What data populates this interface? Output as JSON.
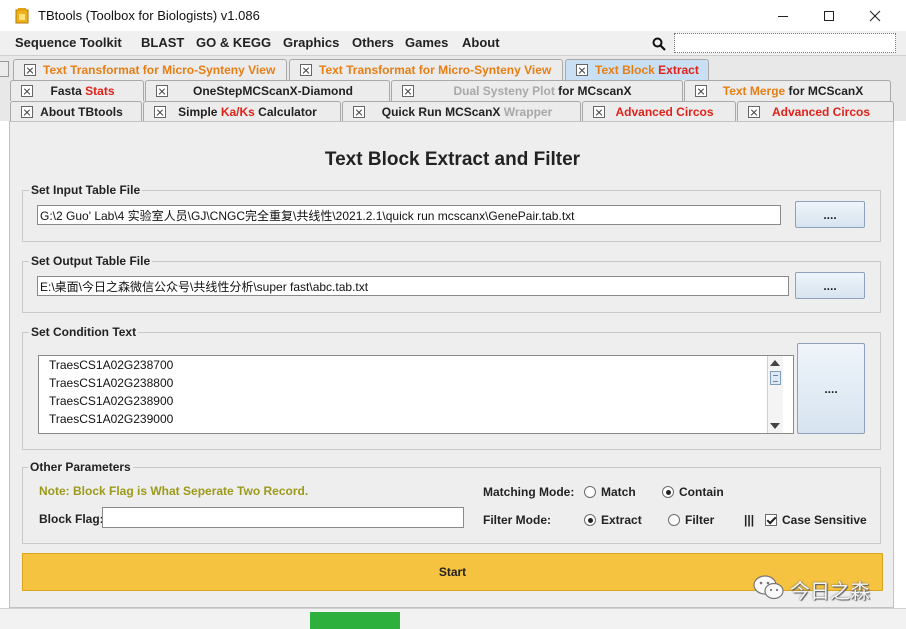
{
  "window": {
    "title": "TBtools (Toolbox for Biologists) v1.086",
    "accent": "#c9dff3",
    "start_color": "#f6c341"
  },
  "menubar": {
    "items": [
      "Sequence Toolkit",
      "BLAST",
      "GO & KEGG",
      "Graphics",
      "Others",
      "Games",
      "About"
    ],
    "search_value": ""
  },
  "tabs": {
    "row1": [
      {
        "segments": [
          {
            "text": "Text Transformat for Micro-Synteny View",
            "tone": "orange"
          }
        ],
        "selected": false
      },
      {
        "segments": [
          {
            "text": "Text Transformat for Micro-Synteny View",
            "tone": "orange"
          }
        ],
        "selected": false
      },
      {
        "segments": [
          {
            "text": "Text Block ",
            "tone": "orange"
          },
          {
            "text": "Extract",
            "tone": "red"
          }
        ],
        "selected": true
      }
    ],
    "row2": [
      {
        "segments": [
          {
            "text": "Fasta ",
            "tone": "dark"
          },
          {
            "text": "Stats",
            "tone": "red"
          }
        ],
        "selected": false
      },
      {
        "segments": [
          {
            "text": "OneStepMCScanX-Diamond",
            "tone": "dark"
          }
        ],
        "selected": false
      },
      {
        "segments": [
          {
            "text": "Dual Systeny ",
            "tone": "gray"
          },
          {
            "text": "Plot ",
            "tone": "gray"
          },
          {
            "text": "for MCscanX",
            "tone": "dark"
          }
        ],
        "selected": false
      },
      {
        "segments": [
          {
            "text": "Text Merge ",
            "tone": "orange"
          },
          {
            "text": "for MCScanX",
            "tone": "dark"
          }
        ],
        "selected": false
      }
    ],
    "row3": [
      {
        "segments": [
          {
            "text": "About TBtools",
            "tone": "dark"
          }
        ],
        "selected": false
      },
      {
        "segments": [
          {
            "text": "Simple ",
            "tone": "dark"
          },
          {
            "text": "Ka/Ks ",
            "tone": "red"
          },
          {
            "text": "Calculator",
            "tone": "dark"
          }
        ],
        "selected": false
      },
      {
        "segments": [
          {
            "text": "Quick Run MCScanX ",
            "tone": "dark"
          },
          {
            "text": "Wrapper",
            "tone": "gray"
          }
        ],
        "selected": false
      },
      {
        "segments": [
          {
            "text": "Advanced Circos",
            "tone": "red"
          }
        ],
        "selected": false
      },
      {
        "segments": [
          {
            "text": "Advanced Circos",
            "tone": "red"
          }
        ],
        "selected": false
      }
    ]
  },
  "panel": {
    "title": "Text Block Extract and Filter",
    "input_group_label": "Set Input Table File",
    "input_path": "G:\\2 Guo' Lab\\4 实验室人员\\GJ\\CNGC完全重复\\共线性\\2021.2.1\\quick run mcscanx\\GenePair.tab.txt",
    "output_group_label": "Set Output Table File",
    "output_path": "E:\\桌面\\今日之森微信公众号\\共线性分析\\super fast\\abc.tab.txt",
    "browse_label": "....",
    "condition_group_label": "Set Condition Text",
    "condition_lines": [
      "TraesCS1A02G238700",
      "TraesCS1A02G238800",
      "TraesCS1A02G238900",
      "TraesCS1A02G239000"
    ],
    "other_group_label": "Other Parameters",
    "note": "Note: Block Flag is What Seperate Two Record.",
    "block_flag_label": "Block Flag:",
    "block_flag_value": "",
    "matching_mode_label": "Matching Mode:",
    "match_label": "Match",
    "contain_label": "Contain",
    "matching_selected": "Contain",
    "filter_mode_label": "Filter Mode:",
    "extract_label": "Extract",
    "filter_label": "Filter",
    "filter_selected": "Extract",
    "separator": "|||",
    "case_sensitive_label": "Case Sensitive",
    "case_sensitive": true,
    "start_label": "Start"
  },
  "watermark": {
    "text": "今日之森"
  }
}
